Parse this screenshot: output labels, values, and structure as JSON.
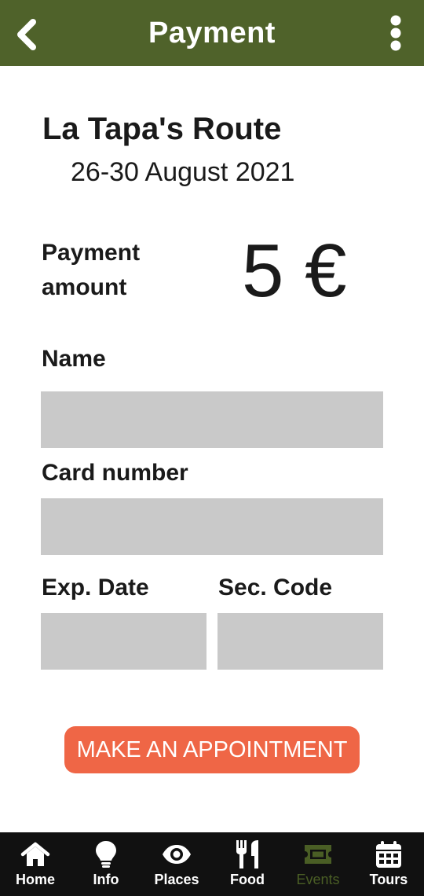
{
  "header": {
    "title": "Payment",
    "back_icon": "chevron-left-icon",
    "menu_icon": "more-vertical-icon",
    "background_color": "#4f622a"
  },
  "event": {
    "title": "La Tapa's Route",
    "dates": "26-30 August 2021"
  },
  "payment": {
    "label": "Payment amount",
    "amount": "5 €"
  },
  "form": {
    "name": {
      "label": "Name",
      "value": "",
      "placeholder": ""
    },
    "card_number": {
      "label": "Card number",
      "value": "",
      "placeholder": ""
    },
    "exp_date": {
      "label": "Exp. Date",
      "value": "",
      "placeholder": ""
    },
    "sec_code": {
      "label": "Sec. Code",
      "value": "",
      "placeholder": ""
    }
  },
  "appointment_button": {
    "label": "MAKE AN APPOINTMENT",
    "color": "#ef6646"
  },
  "bottom_nav": {
    "active_color": "#4a5e25",
    "items": [
      {
        "label": "Home",
        "icon": "home-icon",
        "active": false
      },
      {
        "label": "Info",
        "icon": "lightbulb-icon",
        "active": false
      },
      {
        "label": "Places",
        "icon": "eye-icon",
        "active": false
      },
      {
        "label": "Food",
        "icon": "utensils-icon",
        "active": false
      },
      {
        "label": "Events",
        "icon": "ticket-icon",
        "active": true
      },
      {
        "label": "Tours",
        "icon": "calendar-icon",
        "active": false
      }
    ]
  }
}
